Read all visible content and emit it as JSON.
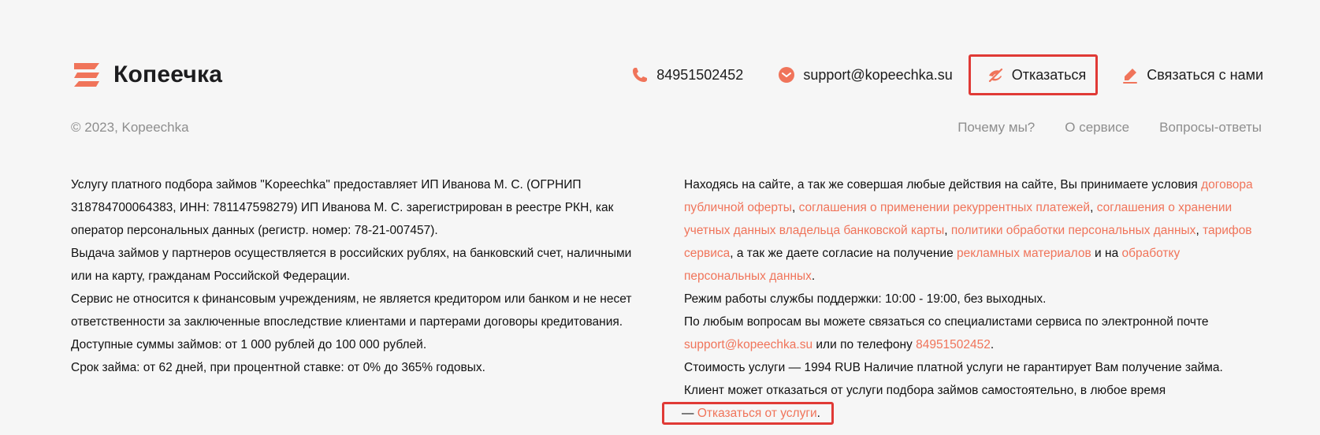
{
  "brand": {
    "name": "Копеечка",
    "accent_color": "#f0745a",
    "highlight_border_color": "#e03a36"
  },
  "header": {
    "phone": {
      "icon": "phone-icon",
      "label": "84951502452"
    },
    "email": {
      "icon": "mail-icon",
      "label": "support@kopeechka.su"
    },
    "refuse": {
      "icon": "cancel-icon",
      "label": "Отказаться"
    },
    "contact": {
      "icon": "pen-icon",
      "label": "Связаться с нами"
    }
  },
  "footer_nav": {
    "copyright": "© 2023, Kopeechka",
    "links": [
      "Почему мы?",
      "О сервисе",
      "Вопросы-ответы"
    ]
  },
  "left_column": {
    "paragraphs": [
      "Услугу платного подбора займов \"Kopeechka\" предоставляет ИП Иванова М. С. (ОГРНИП 318784700064383, ИНН: 781147598279) ИП Иванова М. С. зарегистрирован в реестре РКН, как оператор персональных данных (регистр. номер: 78-21-007457).",
      "Выдача займов у партнеров осуществляется в российских рублях, на банковский счет, наличными или на карту, гражданам Российской Федерации.",
      "Сервис не относится к финансовым учреждениям, не является кредитором или банком и не несет ответственности за заключенные впоследствие клиентами и партерами договоры кредитования. Доступные суммы займов: от 1 000 рублей до 100 000 рублей.",
      "Срок займа: от 62 дней, при процентной ставке: от 0% до 365% годовых."
    ]
  },
  "right_column": {
    "terms": {
      "intro": "Находясь на сайте, а так же совершая любые действия на сайте, Вы принимаете условия ",
      "offer_link": "договора публичной оферты",
      "sep1": ", ",
      "recurrent_link": "соглашения о применении рекуррентных платежей",
      "sep2": ", ",
      "card_link": "соглашения о хранении учетных данных владельца банковской карты",
      "sep3": ", ",
      "privacy_link": "политики обработки персональных данных",
      "sep4": ", ",
      "tariffs_link": "тарифов сервиса",
      "consent_text": ", а так же даете согласие на получение ",
      "ads_link": "рекламных материалов",
      "and_text": " и на ",
      "processing_link": "обработку персональных данных",
      "end": "."
    },
    "hours": "Режим работы службы поддержки: 10:00 - 19:00, без выходных.",
    "contact": {
      "text": "По любым вопросам вы можете связаться со специалистами сервиса по электронной почте ",
      "email_link": "support@kopeechka.su",
      "phone_text": " или по телефону ",
      "phone_link": "84951502452",
      "end": "."
    },
    "price": {
      "text": "Стоимость услуги — 1994 RUB Наличие платной услуги не гарантирует Вам получение займа. Клиент может отказаться от услуги подбора займов самостоятельно, в любое время ",
      "dash": "— ",
      "refuse_link": "Отказаться от услуги",
      "end": "."
    }
  }
}
